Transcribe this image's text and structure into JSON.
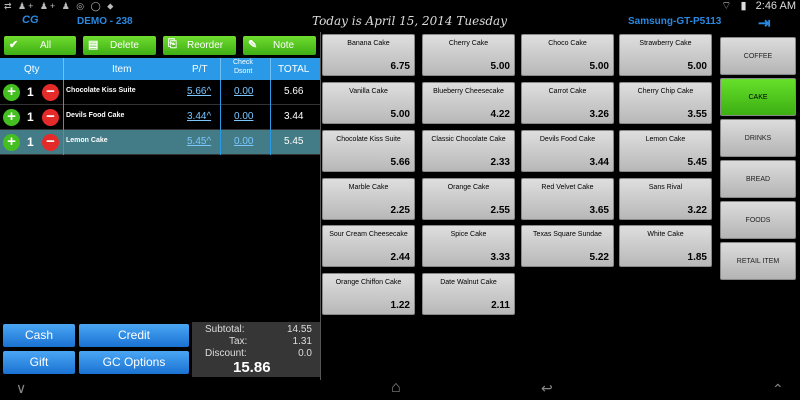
{
  "status_bar": {
    "left_icons": "⇄ ♟+ ♟+ ♟ ◎ ◯ ⬥",
    "wifi": "⌔",
    "battery": "▮",
    "time": "2:46 AM"
  },
  "header": {
    "logo": "CG",
    "store": "DEMO - 238",
    "date_text": "Today is April 15, 2014   Tuesday",
    "device": "Samsung-GT-P5113",
    "logout_icon": "⇥"
  },
  "toolbar": {
    "all": "All",
    "delete": "Delete",
    "reorder": "Reorder",
    "note": "Note"
  },
  "columns": {
    "qty": "Qty",
    "item": "Item",
    "pt": "P/T",
    "check": "Check",
    "dsont": "Dsont",
    "total": "TOTAL"
  },
  "order": {
    "items": [
      {
        "qty": "1",
        "name": "Chocolate Kiss Suite",
        "price": "5.66^",
        "discount": "0.00",
        "total": "5.66",
        "selected": false
      },
      {
        "qty": "1",
        "name": "Devils Food Cake",
        "price": "3.44^",
        "discount": "0.00",
        "total": "3.44",
        "selected": false
      },
      {
        "qty": "1",
        "name": "Lemon Cake",
        "price": "5.45^",
        "discount": "0.00",
        "total": "5.45",
        "selected": true
      }
    ]
  },
  "payment": {
    "cash": "Cash",
    "credit": "Credit",
    "gift": "Gift",
    "gc_options": "GC Options"
  },
  "totals": {
    "subtotal_label": "Subtotal:",
    "subtotal": "14.55",
    "tax_label": "Tax:",
    "tax": "1.31",
    "discount_label": "Discount:",
    "discount": "0.0",
    "grand_total": "15.86"
  },
  "products": [
    {
      "name": "Banana Cake",
      "price": "6.75"
    },
    {
      "name": "Cherry Cake",
      "price": "5.00"
    },
    {
      "name": "Choco Cake",
      "price": "5.00"
    },
    {
      "name": "Strawberry Cake",
      "price": "5.00"
    },
    {
      "name": "Vanilla Cake",
      "price": "5.00"
    },
    {
      "name": "Blueberry Cheesecake",
      "price": "4.22"
    },
    {
      "name": "Carrot Cake",
      "price": "3.26"
    },
    {
      "name": "Cherry Chip Cake",
      "price": "3.55"
    },
    {
      "name": "Chocolate Kiss Suite",
      "price": "5.66"
    },
    {
      "name": "Classic Chocolate Cake",
      "price": "2.33"
    },
    {
      "name": "Devils Food Cake",
      "price": "3.44"
    },
    {
      "name": "Lemon Cake",
      "price": "5.45"
    },
    {
      "name": "Marble Cake",
      "price": "2.25"
    },
    {
      "name": "Orange Cake",
      "price": "2.55"
    },
    {
      "name": "Red Velvet Cake",
      "price": "3.65"
    },
    {
      "name": "Sans Rival",
      "price": "3.22"
    },
    {
      "name": "Sour Cream Cheesecake",
      "price": "2.44"
    },
    {
      "name": "Spice Cake",
      "price": "3.33"
    },
    {
      "name": "Texas Square Sundae",
      "price": "5.22"
    },
    {
      "name": "White Cake",
      "price": "1.85"
    },
    {
      "name": "Orange Chiffon Cake",
      "price": "1.22"
    },
    {
      "name": "Date Walnut Cake",
      "price": "2.11"
    }
  ],
  "categories": [
    {
      "name": "COFFEE",
      "active": false
    },
    {
      "name": "CAKE",
      "active": true
    },
    {
      "name": "DRINKS",
      "active": false
    },
    {
      "name": "BREAD",
      "active": false
    },
    {
      "name": "FOODS",
      "active": false
    },
    {
      "name": "RETAIL ITEM",
      "active": false
    }
  ],
  "navbar": {
    "back": "∨",
    "home": "⌂",
    "recent": "↩",
    "menu": "⌃"
  },
  "colors": {
    "accent_blue": "#2a9ae8",
    "accent_green": "#43c020",
    "danger_red": "#e52a2a",
    "selected_row": "#437c86"
  }
}
